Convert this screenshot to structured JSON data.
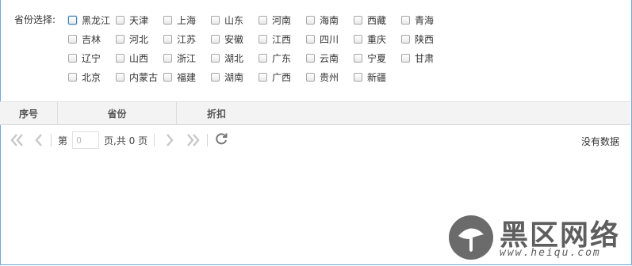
{
  "filter": {
    "label": "省份选择:",
    "provinces": [
      "黑龙江",
      "天津",
      "上海",
      "山东",
      "河南",
      "海南",
      "西藏",
      "青海",
      "吉林",
      "河北",
      "江苏",
      "安徽",
      "江西",
      "四川",
      "重庆",
      "陕西",
      "辽宁",
      "山西",
      "浙江",
      "湖北",
      "广东",
      "云南",
      "宁夏",
      "甘肃",
      "北京",
      "内蒙古",
      "福建",
      "湖南",
      "广西",
      "贵州",
      "新疆"
    ]
  },
  "grid": {
    "columns": [
      "序号",
      "省份",
      "折扣"
    ]
  },
  "pager": {
    "first_icon": "double-chevron-left-icon",
    "prev_icon": "chevron-left-icon",
    "page_prefix": "第",
    "page_value": "0",
    "page_suffix": "页,共 0 页",
    "next_icon": "chevron-right-icon",
    "last_icon": "double-chevron-right-icon",
    "refresh_icon": "refresh-icon",
    "empty_text": "没有数据"
  },
  "watermark": {
    "text": "黑区网络",
    "url": "www.heiqu.com"
  },
  "colors": {
    "accent_border": "#6fa8dc",
    "header_bg": "#f3f3f3"
  }
}
